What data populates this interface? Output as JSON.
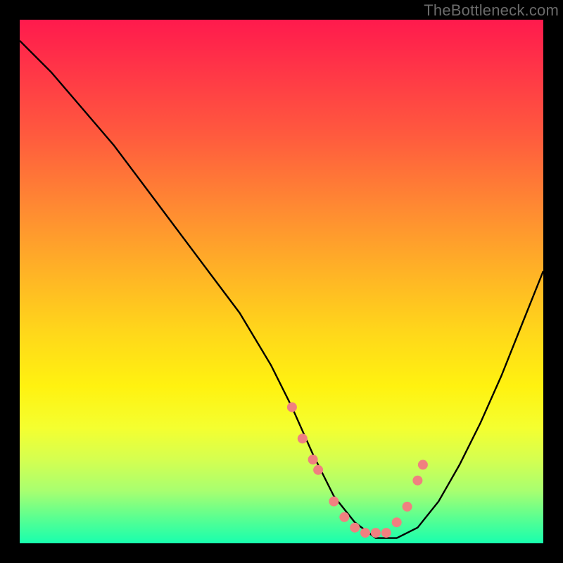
{
  "watermark": "TheBottleneck.com",
  "chart_data": {
    "type": "line",
    "title": "",
    "xlabel": "",
    "ylabel": "",
    "ylim": [
      0,
      100
    ],
    "xlim": [
      0,
      100
    ],
    "series": [
      {
        "name": "bottleneck-curve",
        "x": [
          0,
          6,
          12,
          18,
          24,
          30,
          36,
          42,
          48,
          52,
          56,
          60,
          64,
          68,
          72,
          76,
          80,
          84,
          88,
          92,
          96,
          100
        ],
        "y": [
          96,
          90,
          83,
          76,
          68,
          60,
          52,
          44,
          34,
          26,
          17,
          9,
          4,
          1,
          1,
          3,
          8,
          15,
          23,
          32,
          42,
          52
        ]
      }
    ],
    "markers": {
      "name": "highlight-dots",
      "color": "#f08080",
      "x": [
        52,
        54,
        56,
        57,
        60,
        62,
        64,
        66,
        68,
        70,
        72,
        74,
        76,
        77
      ],
      "y": [
        26,
        20,
        16,
        14,
        8,
        5,
        3,
        2,
        2,
        2,
        4,
        7,
        12,
        15
      ]
    },
    "colors": {
      "gradient_top": "#ff1a4d",
      "gradient_mid": "#ffe812",
      "gradient_bottom": "#18ffae",
      "curve": "#000000",
      "marker": "#f08080"
    }
  }
}
